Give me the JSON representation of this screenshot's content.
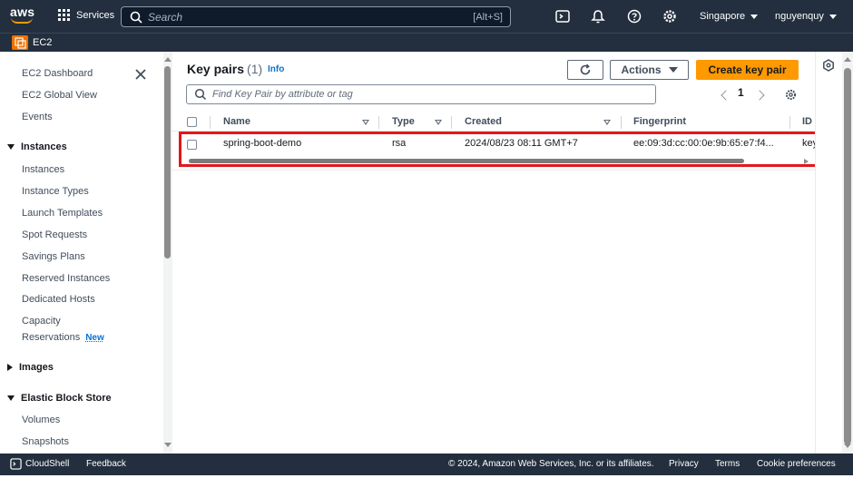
{
  "topnav": {
    "logo_text": "aws",
    "services_label": "Services",
    "search_placeholder": "Search",
    "search_shortcut": "[Alt+S]",
    "region": "Singapore",
    "user": "nguyenquy"
  },
  "servicebar": {
    "service": "EC2"
  },
  "sidebar": {
    "items": [
      {
        "label": "EC2 Dashboard"
      },
      {
        "label": "EC2 Global View"
      },
      {
        "label": "Events"
      }
    ],
    "sections": [
      {
        "label": "Instances",
        "expanded": true,
        "items": [
          "Instances",
          "Instance Types",
          "Launch Templates",
          "Spot Requests",
          "Savings Plans",
          "Reserved Instances",
          "Dedicated Hosts",
          "Capacity",
          "Reservations"
        ]
      },
      {
        "label": "Images",
        "expanded": false
      },
      {
        "label": "Elastic Block Store",
        "expanded": true,
        "items": [
          "Volumes",
          "Snapshots"
        ]
      }
    ],
    "new_badge": "New"
  },
  "main": {
    "title": "Key pairs",
    "count": "(1)",
    "info": "Info",
    "actions_label": "Actions",
    "create_label": "Create key pair",
    "filter_placeholder": "Find Key Pair by attribute or tag",
    "page": "1",
    "columns": [
      "Name",
      "Type",
      "Created",
      "Fingerprint",
      "ID"
    ],
    "rows": [
      {
        "name": "spring-boot-demo",
        "type": "rsa",
        "created": "2024/08/23 08:11 GMT+7",
        "fingerprint": "ee:09:3d:cc:00:0e:9b:65:e7:f4...",
        "id": "key"
      }
    ]
  },
  "footer": {
    "cloudshell": "CloudShell",
    "feedback": "Feedback",
    "copyright": "© 2024, Amazon Web Services, Inc. or its affiliates.",
    "privacy": "Privacy",
    "terms": "Terms",
    "cookies": "Cookie preferences"
  },
  "colors": {
    "nav_bg": "#232f3e",
    "primary": "#ff9900",
    "link": "#0972d3",
    "highlight": "#e4161b"
  }
}
